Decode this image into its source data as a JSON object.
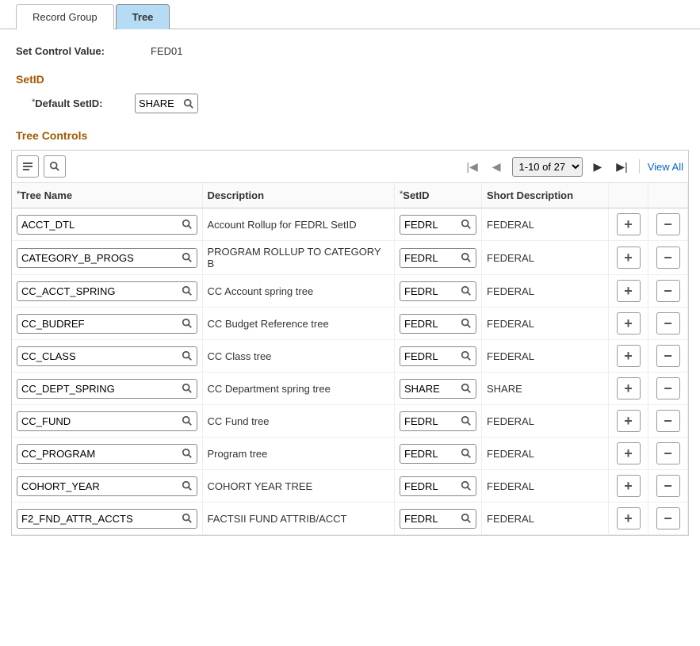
{
  "tabs": {
    "record_group": "Record Group",
    "tree": "Tree"
  },
  "set_control": {
    "label": "Set Control Value:",
    "value": "FED01"
  },
  "setid_section": {
    "title": "SetID",
    "default_label": "Default SetID:",
    "default_value": "SHARE"
  },
  "grid": {
    "title": "Tree Controls",
    "pager_text": "1-10 of 27",
    "view_all": "View All",
    "headers": {
      "tree_name": "Tree Name",
      "description": "Description",
      "setid": "SetID",
      "short_desc": "Short Description"
    },
    "rows": [
      {
        "tree": "ACCT_DTL",
        "desc": "Account Rollup for FEDRL SetID",
        "setid": "FEDRL",
        "short": "FEDERAL"
      },
      {
        "tree": "CATEGORY_B_PROGS",
        "desc": "PROGRAM ROLLUP TO CATEGORY B",
        "setid": "FEDRL",
        "short": "FEDERAL"
      },
      {
        "tree": "CC_ACCT_SPRING",
        "desc": "CC Account spring tree",
        "setid": "FEDRL",
        "short": "FEDERAL"
      },
      {
        "tree": "CC_BUDREF",
        "desc": "CC Budget Reference tree",
        "setid": "FEDRL",
        "short": "FEDERAL"
      },
      {
        "tree": "CC_CLASS",
        "desc": "CC Class tree",
        "setid": "FEDRL",
        "short": "FEDERAL"
      },
      {
        "tree": "CC_DEPT_SPRING",
        "desc": "CC Department spring tree",
        "setid": "SHARE",
        "short": "SHARE"
      },
      {
        "tree": "CC_FUND",
        "desc": "CC Fund tree",
        "setid": "FEDRL",
        "short": "FEDERAL"
      },
      {
        "tree": "CC_PROGRAM",
        "desc": "Program tree",
        "setid": "FEDRL",
        "short": "FEDERAL"
      },
      {
        "tree": "COHORT_YEAR",
        "desc": "COHORT YEAR TREE",
        "setid": "FEDRL",
        "short": "FEDERAL"
      },
      {
        "tree": "F2_FND_ATTR_ACCTS",
        "desc": "FACTSII FUND ATTRIB/ACCT",
        "setid": "FEDRL",
        "short": "FEDERAL"
      }
    ]
  }
}
